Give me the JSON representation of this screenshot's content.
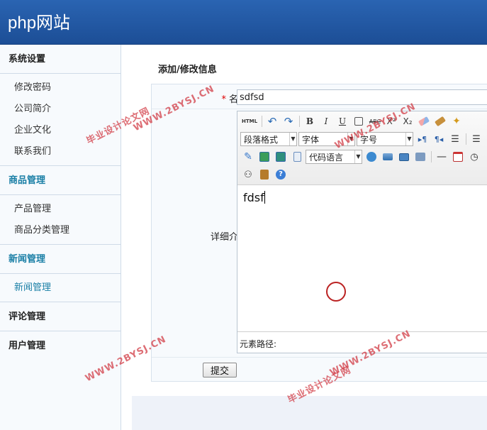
{
  "site_title": "php网站",
  "sidebar": {
    "groups": [
      {
        "title": "系统设置",
        "items": [
          "修改密码",
          "公司简介",
          "企业文化",
          "联系我们"
        ]
      },
      {
        "title": "商品管理",
        "items": [
          "产品管理",
          "商品分类管理"
        ]
      },
      {
        "title": "新闻管理",
        "items": [
          "新闻管理"
        ]
      },
      {
        "title": "评论管理",
        "items": []
      },
      {
        "title": "用户管理",
        "items": []
      }
    ]
  },
  "page_title": "添加/修改信息",
  "form": {
    "required_mark": "*",
    "name_label": "名称：",
    "name_value": "sdfsd",
    "detail_label": "详细介绍：",
    "submit_label": "提交"
  },
  "editor": {
    "html_button": "HTML",
    "paragraph_select": "段落格式",
    "font_select": "字体",
    "size_select": "字号",
    "code_select": "代码语言",
    "content": "fdsf",
    "path_label": "元素路径:"
  },
  "watermark": {
    "url": "WWW.2BYSJ.CN",
    "cn": "毕业设计论文网"
  },
  "colors": {
    "header": "#1f56a0",
    "active_link": "#1a7fa6",
    "watermark": "#d23c46"
  }
}
